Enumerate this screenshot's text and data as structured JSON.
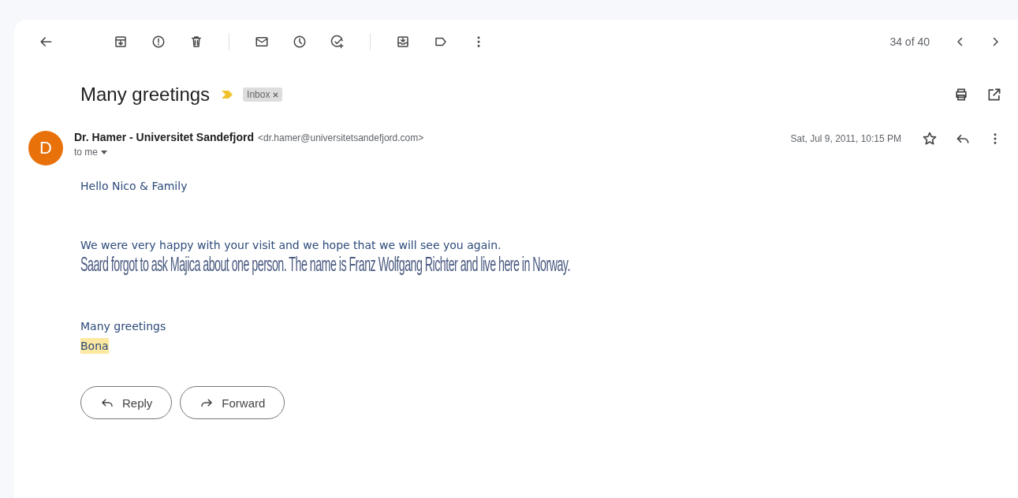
{
  "toolbar": {
    "position": "34 of 40"
  },
  "subject": {
    "title": "Many greetings",
    "important": true,
    "labels": [
      {
        "text": "Inbox",
        "removable": true
      }
    ]
  },
  "message": {
    "avatar_letter": "D",
    "sender_name": "Dr. Hamer - Universitet Sandefjord",
    "sender_email": "<dr.hamer@universitetsandefjord.com>",
    "recipient": "to me",
    "date": "Sat, Jul 9, 2011, 10:15 PM",
    "starred": false,
    "body": [
      {
        "kind": "line",
        "text": "Hello Nico & Family"
      },
      {
        "kind": "gap"
      },
      {
        "kind": "line",
        "text": "We were very happy with your visit and we hope that we will see you again."
      },
      {
        "kind": "distorted",
        "text": "Saard forgot to ask Majica about one person. The name is Franz Wolfgang Richter and live here in Norway."
      },
      {
        "kind": "gap"
      },
      {
        "kind": "line",
        "text": "Many greetings"
      },
      {
        "kind": "highlight",
        "text": "Bona"
      }
    ]
  },
  "actions": [
    "Reply",
    "Forward"
  ]
}
